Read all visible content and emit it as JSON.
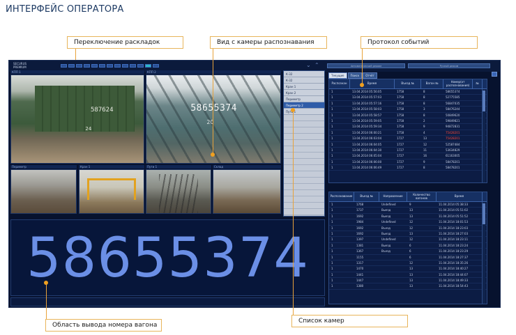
{
  "page": {
    "title": "ИНТЕРФЕЙС ОПЕРАТОРА"
  },
  "colors": {
    "accent": "#6b8fe6",
    "callout_border": "#e8b45a",
    "alarm": "#ff4a3a",
    "background": "#07122e"
  },
  "app": {
    "logo_line1": "SECURUS",
    "logo_line2": "PREMIUM",
    "layout_buttons": 13,
    "active_layout": 11
  },
  "cameras": {
    "top_left_label": "КПП 1",
    "top_right_label": "КПП 2",
    "thumb_labels": [
      "Периметр",
      "Кран 1",
      "Пути 1",
      "Склад"
    ],
    "cam_a_number": "587624",
    "cam_a_number2": "24",
    "cam_b_number": "58655374",
    "cam_b_number2": "20"
  },
  "camera_list": {
    "items": [
      "К-32",
      "К-32",
      "Кран 1",
      "Кран 2",
      "Периметр",
      "Периметр 2",
      "Пути 1"
    ],
    "selected_index": 5
  },
  "wagon_number": {
    "value": "58655374"
  },
  "right_panel": {
    "buttons": [
      "Автоматический режим",
      "Ручной режим"
    ],
    "tabs": [
      "Текущие",
      "Поиск",
      "Отчёт"
    ],
    "active_tab": 0,
    "events_table": {
      "headers": [
        "Распознан",
        "Время",
        "Въезд №",
        "Вагон №",
        "Номер(от распознавания)",
        "№"
      ],
      "rows": [
        [
          "1",
          "13.04.2014 05:56:05",
          "1758",
          "8",
          "58655374",
          ""
        ],
        [
          "1",
          "13.04.2014 05:57:03",
          "1758",
          "8",
          "52775585",
          ""
        ],
        [
          "1",
          "13.04.2014 05:57:16",
          "1758",
          "8",
          "56847035",
          ""
        ],
        [
          "1",
          "13.04.2014 05:58:03",
          "1758",
          "3",
          "58476244",
          ""
        ],
        [
          "1",
          "13.04.2014 05:58:57",
          "1758",
          "8",
          "50849620",
          ""
        ],
        [
          "1",
          "13.04.2014 05:59:05",
          "1758",
          "2",
          "59849821",
          ""
        ],
        [
          "1",
          "13.04.2014 05:59:34",
          "1758",
          "9",
          "94872831",
          ""
        ],
        [
          "1",
          "13.04.2014 06:00:21",
          "1758",
          "4",
          "75428201",
          ""
        ],
        [
          "1",
          "13.04.2014 06:03:04",
          "1727",
          "13",
          "75428201",
          ""
        ],
        [
          "1",
          "13.04.2014 06:04:05",
          "1727",
          "12",
          "52587484",
          ""
        ],
        [
          "1",
          "13.04.2014 06:04:30",
          "1727",
          "11",
          "53634829",
          ""
        ],
        [
          "1",
          "13.04.2014 06:05:04",
          "1727",
          "16",
          "61163005",
          ""
        ],
        [
          "1",
          "13.04.2014 06:06:00",
          "1727",
          "9",
          "58478201",
          ""
        ],
        [
          "1",
          "13.04.2014 06:06:49",
          "1727",
          "8",
          "58478201",
          ""
        ]
      ],
      "red_rows": [
        7,
        8
      ]
    },
    "passages_table": {
      "headers": [
        "Распознавание",
        "Въезд №",
        "Направление",
        "Количество вагонов",
        "Время"
      ],
      "rows": [
        [
          "1",
          "1768",
          "Undefined",
          "9",
          "11.04.2014 05:38:33"
        ],
        [
          "1",
          "1737",
          "Выезд",
          "13",
          "11.04.2014 05:51:02"
        ],
        [
          "1",
          "1692",
          "Выезд",
          "13",
          "11.04.2014 05:51:52"
        ],
        [
          "1",
          "1984",
          "Undefined",
          "12",
          "11.04.2014 18:01:53"
        ],
        [
          "1",
          "1692",
          "Въезд",
          "12",
          "11.04.2014 18:23:03"
        ],
        [
          "1",
          "1692",
          "Выезд",
          "13",
          "11.04.2014 18:27:03"
        ],
        [
          "1",
          "1397",
          "Undefined",
          "12",
          "11.04.2014 18:23:11"
        ],
        [
          "1",
          "1381",
          "Выезд",
          "6",
          "11.04.2014 18:23:24"
        ],
        [
          "1",
          "1367",
          "Въезд",
          "6",
          "11.04.2014 18:23:29"
        ],
        [
          "1",
          "1155",
          "",
          "6",
          "11.04.2014 18:27:37"
        ],
        [
          "1",
          "1317",
          "",
          "12",
          "11.04.2014 18:35:26"
        ],
        [
          "1",
          "1470",
          "",
          "13",
          "11.04.2014 18:40:27"
        ],
        [
          "1",
          "1441",
          "",
          "13",
          "11.04.2014 18:44:07"
        ],
        [
          "1",
          "1447",
          "",
          "13",
          "11.04.2014 18:49:33"
        ],
        [
          "1",
          "1380",
          "",
          "13",
          "11.04.2014 18:54:43"
        ]
      ]
    }
  },
  "callouts": {
    "layouts": "Переключение раскладок",
    "recognition_camera": "Вид с камеры распознавания",
    "event_log": "Протокол событий",
    "wagon_number_area": "Область вывода номера вагона",
    "camera_list": "Список камер"
  }
}
